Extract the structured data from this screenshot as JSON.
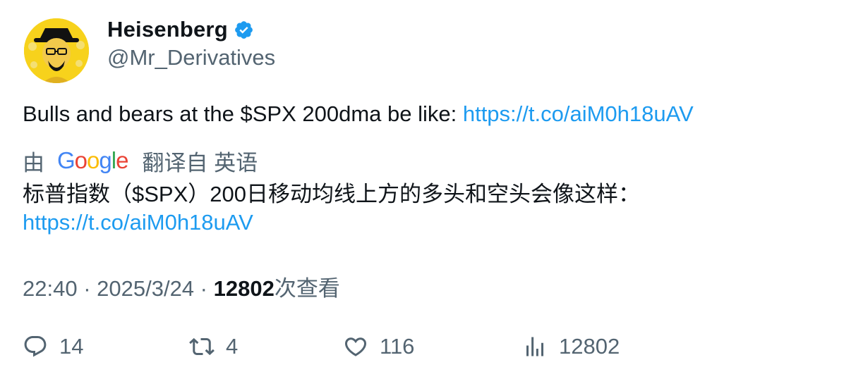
{
  "author": {
    "display_name": "Heisenberg",
    "handle": "@Mr_Derivatives",
    "verified_icon": "verified-badge-icon",
    "avatar_icon": "heisenberg-avatar"
  },
  "tweet": {
    "text": "Bulls and bears at the $SPX 200dma be like: ",
    "link": "https://t.co/aiM0h18uAV"
  },
  "translation": {
    "by_label": "由",
    "provider": "Google",
    "from_label": "翻译自 英语",
    "text": "标普指数（$SPX）200日移动均线上方的多头和空头会像这样：",
    "link": "https://t.co/aiM0h18uAV"
  },
  "meta": {
    "time": "22:40",
    "separator1": " · ",
    "date": "2025/3/24",
    "separator2": " · ",
    "views_count": "12802",
    "views_label": "次查看"
  },
  "actions": {
    "replies": "14",
    "retweets": "4",
    "likes": "116",
    "views": "12802"
  },
  "colors": {
    "link": "#1d9bf0",
    "secondary_text": "#536471",
    "avatar_bg": "#f7d21c"
  }
}
